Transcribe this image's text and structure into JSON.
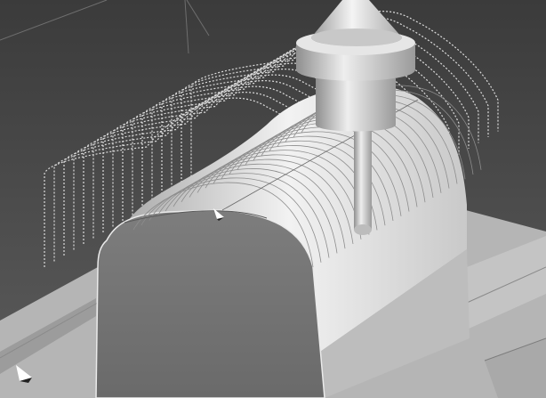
{
  "viewport": {
    "background_top": "#3f3f3f",
    "background_bottom": "#5a5a5a",
    "toolpath_color": "#d9d9d9",
    "part_color": "#b9b9b9",
    "part_shadow": "#7a7a7a",
    "tool_color": "#cfcfcf"
  },
  "icons": {
    "origin_marker": "axis-triad-icon",
    "cursor_marker": "triad-cursor-icon"
  }
}
